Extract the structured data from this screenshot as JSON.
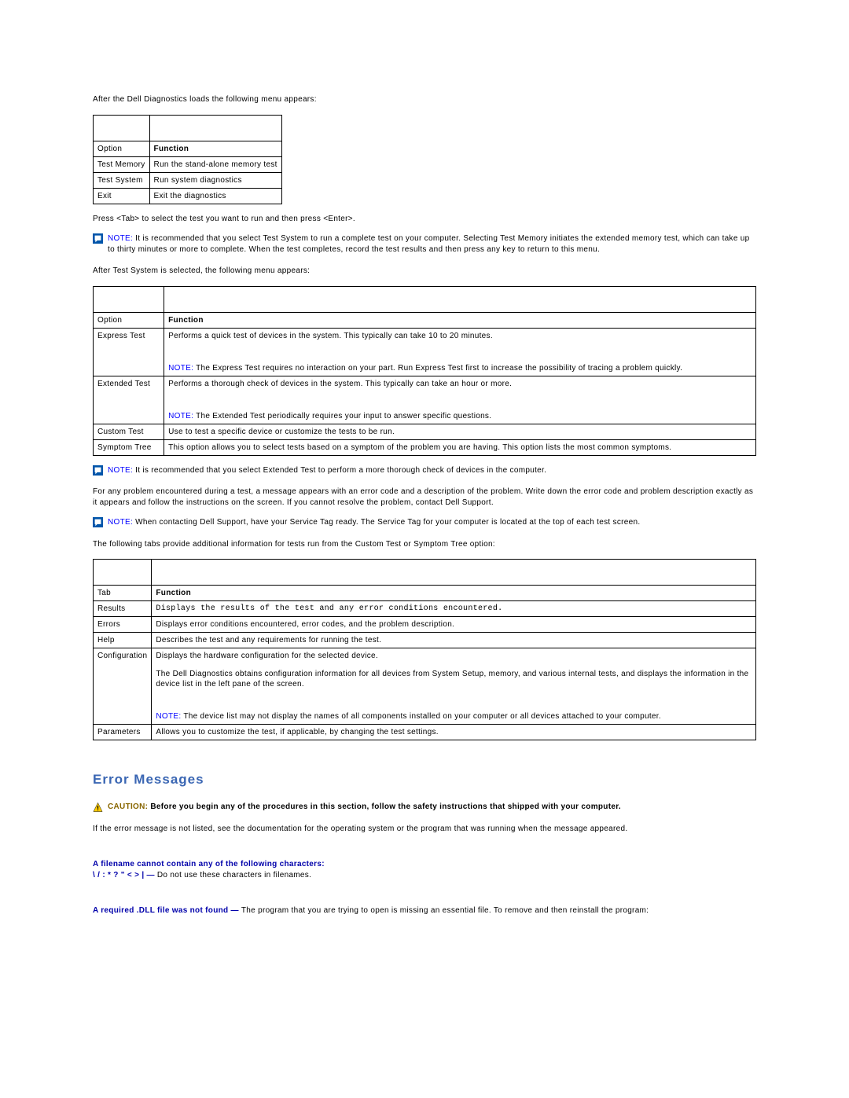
{
  "para1": "After the Dell Diagnostics loads the following menu appears:",
  "table1": {
    "headers": {
      "c0": "Option",
      "c1": "Function"
    },
    "r0": {
      "c0": "Test Memory",
      "c1": "Run the stand-alone memory test"
    },
    "r1": {
      "c0": "Test System",
      "c1": "Run system diagnostics"
    },
    "r2": {
      "c0": "Exit",
      "c1": "Exit the diagnostics"
    }
  },
  "para2": "Press <Tab> to select the test you want to run and then press <Enter>.",
  "note1": {
    "label": "NOTE:",
    "text": " It is recommended that you select Test System to run a complete test on your computer. Selecting Test Memory initiates the extended memory test, which can take up to thirty minutes or more to complete. When the test completes, record the test results and then press any key to return to this menu."
  },
  "para3": "After Test System is selected, the following menu appears:",
  "table2": {
    "headers": {
      "c0": "Option",
      "c1": "Function"
    },
    "r0": {
      "c0": "Express Test",
      "c1a": "Performs a quick test of devices in the system. This typically can take 10 to 20 minutes.",
      "c1b_label": "NOTE:",
      "c1b": " The Express Test requires no interaction on your part. Run Express Test first to increase the possibility of tracing a problem quickly."
    },
    "r1": {
      "c0": "Extended Test",
      "c1a": "Performs a thorough check of devices in the system. This typically can take an hour or more.",
      "c1b_label": "NOTE:",
      "c1b": " The Extended Test periodically requires your input to answer specific questions."
    },
    "r2": {
      "c0": "Custom Test",
      "c1": "Use to test a specific device or customize the tests to be run."
    },
    "r3": {
      "c0": "Symptom Tree",
      "c1": "This option allows you to select tests based on a symptom of the problem you are having. This option lists the most common symptoms."
    }
  },
  "note2": {
    "label": "NOTE:",
    "text": " It is recommended that you select Extended Test to perform a more thorough check of devices in the computer."
  },
  "para4": "For any problem encountered during a test, a message appears with an error code and a description of the problem. Write down the error code and problem description exactly as it appears and follow the instructions on the screen. If you cannot resolve the problem, contact Dell Support.",
  "note3": {
    "label": "NOTE:",
    "text": " When contacting Dell Support, have your Service Tag ready. The Service Tag for your computer is located at the top of each test screen."
  },
  "para5": "The following tabs provide additional information for tests run from the Custom Test or Symptom Tree option:",
  "table3": {
    "headers": {
      "c0": "Tab",
      "c1": "Function"
    },
    "r0": {
      "c0": "Results",
      "c1": "Displays the results of the test and any error conditions encountered."
    },
    "r1": {
      "c0": "Errors",
      "c1": "Displays error conditions encountered, error codes, and the problem description."
    },
    "r2": {
      "c0": "Help",
      "c1": "Describes the test and any requirements for running the test."
    },
    "r3": {
      "c0": "Configuration",
      "c1a": "Displays the hardware configuration for the selected device.",
      "c1b": "The Dell Diagnostics obtains configuration information for all devices from System Setup, memory, and various internal tests, and displays the information in the device list in the left pane of the screen.",
      "c1c_label": "NOTE:",
      "c1c": " The device list may not display the names of all components installed on your computer or all devices attached to your computer."
    },
    "r4": {
      "c0": "Parameters",
      "c1": "Allows you to customize the test, if applicable, by changing the test settings."
    }
  },
  "section_heading": "Error Messages",
  "caution1": {
    "label": "CAUTION:",
    "text": " Before you begin any of the procedures in this section, follow the safety instructions that shipped with your computer."
  },
  "para6": "If the error message is not listed, see the documentation for the operating system or the program that was running when the message appeared.",
  "err1": {
    "title": "A filename cannot contain any of the following characters:",
    "chars": "\\ / : * ? \" < > | — ",
    "text": "Do not use these characters in filenames."
  },
  "err2": {
    "title": "A required .DLL file was not found — ",
    "text": "The program that you are trying to open is missing an essential file. To remove and then reinstall the program:"
  }
}
